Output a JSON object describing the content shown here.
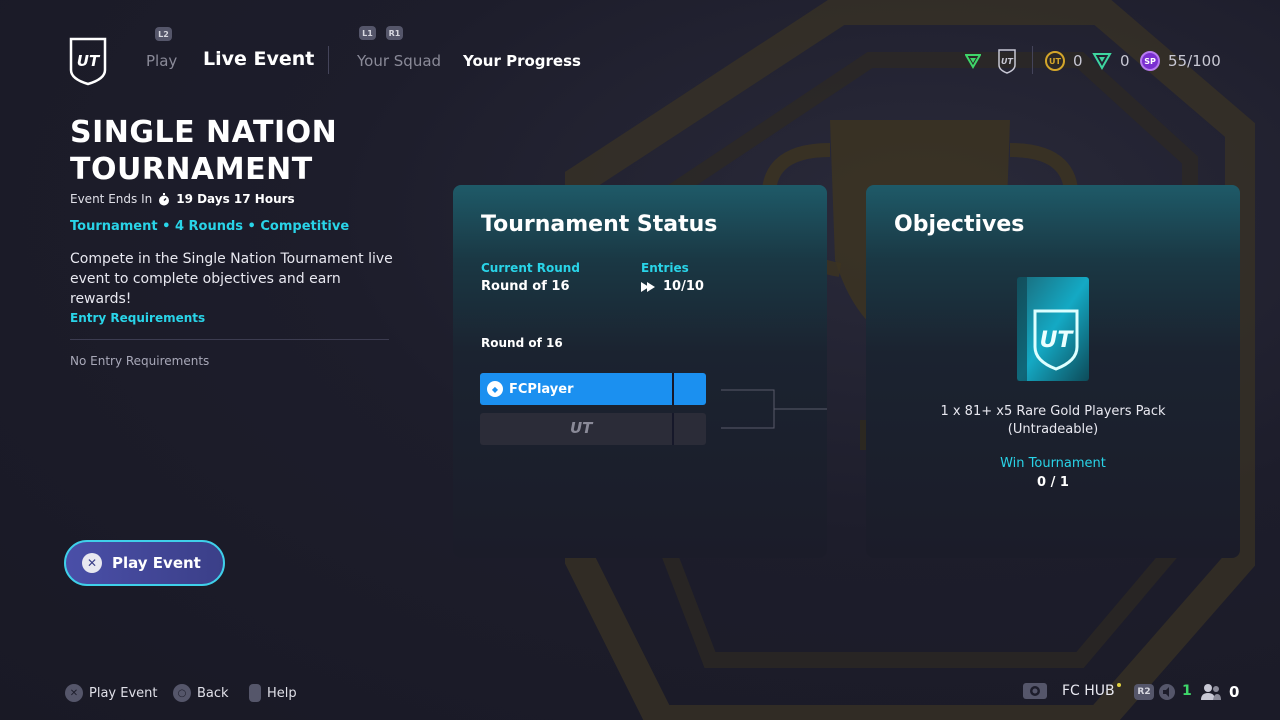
{
  "nav": {
    "l2_hint": "L2",
    "play": "Play",
    "live_event": "Live Event",
    "l1_hint": "L1",
    "r1_hint": "R1",
    "your_squad": "Your Squad",
    "your_progress": "Your Progress"
  },
  "currencies": {
    "coins": "0",
    "points": "0",
    "sp": "55/100"
  },
  "event": {
    "title_line1": "SINGLE NATION",
    "title_line2": "TOURNAMENT",
    "ends_label": "Event Ends In",
    "ends_value": "19 Days 17 Hours",
    "meta": "Tournament • 4 Rounds • Competitive",
    "description": "Compete in the Single Nation Tournament live event to complete objectives and earn rewards!",
    "entry_requirements_label": "Entry Requirements",
    "entry_requirements_text": "No Entry Requirements",
    "play_button": "Play Event"
  },
  "status": {
    "title": "Tournament Status",
    "current_round_label": "Current Round",
    "current_round_value": "Round of 16",
    "entries_label": "Entries",
    "entries_value": "10/10",
    "bracket_round": "Round of 16",
    "player1": "FCPlayer",
    "player2_logo": "UT"
  },
  "objectives": {
    "title": "Objectives",
    "reward": "1 x 81+ x5 Rare Gold Players Pack",
    "reward_note": "(Untradeable)",
    "task": "Win Tournament",
    "progress": "0 / 1"
  },
  "footer": {
    "play_event": "Play Event",
    "back": "Back",
    "help": "Help",
    "hub": "FC HUB",
    "r2_hint": "R2",
    "notifications": "1",
    "friends": "0"
  },
  "colors": {
    "accent": "#29d4e8",
    "player_slot": "#1b90f0",
    "button": "#3b3f88"
  }
}
